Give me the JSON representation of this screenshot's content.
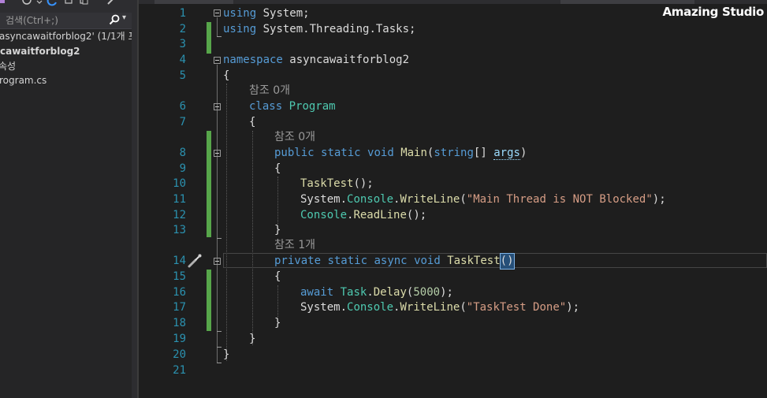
{
  "solution_explorer": {
    "search_placeholder": "검색(Ctrl+;)",
    "items": [
      {
        "label": "asyncawaitforblog2' (1/1개 프로",
        "bold": false
      },
      {
        "label": "cawaitforblog2",
        "bold": true
      },
      {
        "label": "속성",
        "bold": false
      },
      {
        "label": "rogram.cs",
        "bold": false
      }
    ]
  },
  "editor": {
    "watermark": "Amazing Studio",
    "line_numbers": [
      "1",
      "2",
      "3",
      "4",
      "5",
      "6",
      "7",
      "8",
      "9",
      "10",
      "11",
      "12",
      "13",
      "14",
      "15",
      "16",
      "17",
      "18",
      "19",
      "20",
      "21"
    ],
    "codelens": {
      "program": "참조 0개",
      "main": "참조 0개",
      "tasktest": "참조 1개"
    },
    "code": {
      "l1_kw": "using",
      "l1_rest": " System;",
      "l2_kw": "using",
      "l2_rest": " System.Threading.Tasks;",
      "l4_kw": "namespace",
      "l4_rest": " asyncawaitforblog2",
      "l5": "{",
      "l6_kw": "class",
      "l6_type": "Program",
      "l7": "{",
      "l8_kw1": "public",
      "l8_kw2": "static",
      "l8_kw3": "void",
      "l8_method": "Main",
      "l8_p1": "(",
      "l8_kw4": "string",
      "l8_p2": "[] ",
      "l8_param": "args",
      "l8_p3": ")",
      "l9": "{",
      "l10_method": "TaskTest",
      "l10_rest": "();",
      "l11_a": "System.",
      "l11_type": "Console",
      "l11_b": ".",
      "l11_method": "WriteLine",
      "l11_c": "(",
      "l11_str": "\"Main Thread is NOT Blocked\"",
      "l11_d": ");",
      "l12_type": "Console",
      "l12_a": ".",
      "l12_method": "ReadLine",
      "l12_b": "();",
      "l13": "}",
      "l14_kw1": "private",
      "l14_kw2": "static",
      "l14_kw3": "async",
      "l14_kw4": "void",
      "l14_method": "TaskTest",
      "l14_p1": "(",
      "l14_p2": ")",
      "l15": "{",
      "l16_kw": "await",
      "l16_type": "Task",
      "l16_a": ".",
      "l16_method": "Delay",
      "l16_b": "(",
      "l16_num": "5000",
      "l16_c": ");",
      "l17_a": "System.",
      "l17_type": "Console",
      "l17_b": ".",
      "l17_method": "WriteLine",
      "l17_c": "(",
      "l17_str": "\"TaskTest Done\"",
      "l17_d": ");",
      "l18": "}",
      "l19": "}",
      "l20": "}"
    }
  },
  "icons": {
    "search": "search-icon",
    "quick_action": "screwdriver-icon",
    "dropdown": "chevron-down-icon"
  },
  "colors": {
    "editor_bg": "#1e1e1e",
    "keyword": "#569cd6",
    "type": "#4ec9b0",
    "method": "#dcdcaa",
    "string": "#d69d85",
    "number": "#b5cea8",
    "line_number": "#2b91af",
    "change_bar": "#57a64a"
  }
}
